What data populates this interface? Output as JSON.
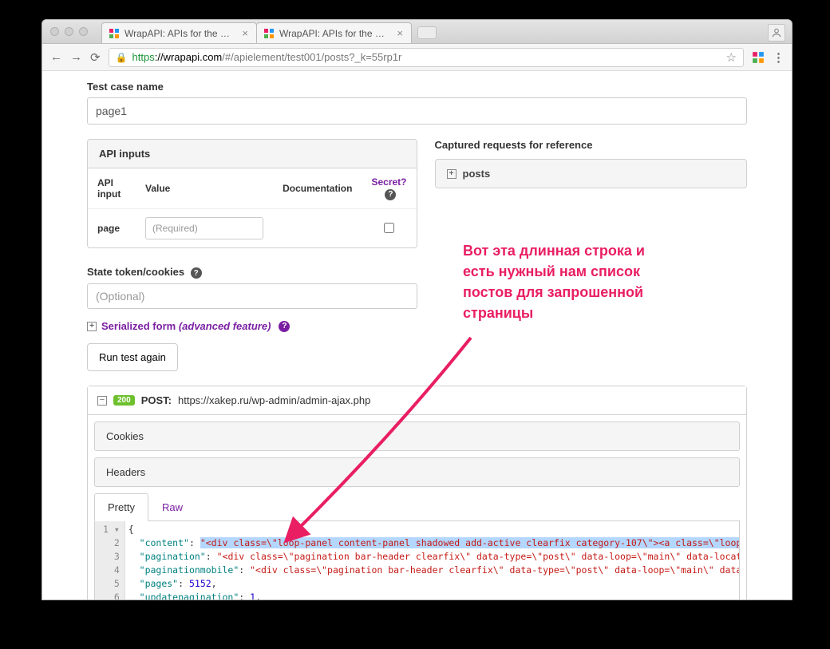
{
  "browser": {
    "tabs": [
      {
        "title": "WrapAPI: APIs for the whole w"
      },
      {
        "title": "WrapAPI: APIs for the whole w"
      }
    ],
    "url_scheme": "https",
    "url_host": "://wrapapi.com",
    "url_path": "/#/apielement/test001/posts?_k=55rp1r"
  },
  "form": {
    "name_label": "Test case name",
    "name_value": "page1",
    "api_inputs_hd": "API inputs",
    "cols": {
      "api_input": "API input",
      "value": "Value",
      "doc": "Documentation",
      "secret": "Secret?"
    },
    "rows": [
      {
        "name": "page",
        "placeholder": "(Required)"
      }
    ],
    "captured_hd": "Captured requests for reference",
    "captured_item": "posts",
    "state_label": "State token/cookies",
    "state_placeholder": "(Optional)",
    "serialized_prefix": "Serialized form ",
    "serialized_em": "(advanced feature)",
    "run_btn": "Run test again"
  },
  "request": {
    "status": "200",
    "method": "POST:",
    "url": "https://xakep.ru/wp-admin/admin-ajax.php",
    "accordion": [
      "Cookies",
      "Headers"
    ],
    "tabs": {
      "pretty": "Pretty",
      "raw": "Raw"
    }
  },
  "code": {
    "line1": "{",
    "l2_key": "\"content\"",
    "l2_val": "\"<div class=\\\"loop-panel content-panel shadowed add-active clearfix category-107\\\"><a class=\\\"loop-link\\",
    "l3_key": "\"pagination\"",
    "l3_val": "\"<div class=\\\"pagination bar-header clearfix\\\" data-type=\\\"post\\\" data-loop=\\\"main\\\" data-location=\\\"",
    "l4_key": "\"paginationmobile\"",
    "l4_val": "\"<div class=\\\"pagination bar-header clearfix\\\" data-type=\\\"post\\\" data-loop=\\\"main\\\" data-locat",
    "l5_key": "\"pages\"",
    "l5_val": "5152",
    "l6_key": "\"updatepagination\"",
    "l6_val": "1",
    "gutter": [
      "1 ▾",
      "2",
      "3",
      "4",
      "5",
      "6"
    ]
  },
  "annotation": {
    "text1": "Вот эта длинная строка и",
    "text2": "есть нужный нам список",
    "text3": "постов для запрошенной",
    "text4": "страницы"
  }
}
